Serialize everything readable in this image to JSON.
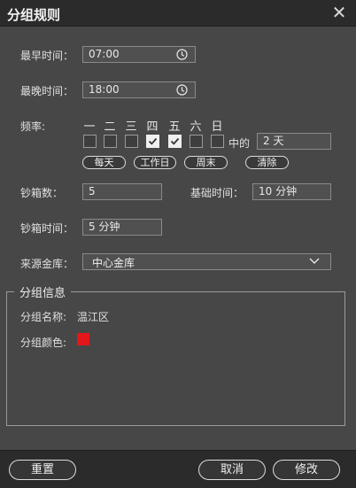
{
  "dialog": {
    "title": "分组规则",
    "close_icon": "close-icon"
  },
  "rules": {
    "earliest_time_label": "最早时间：",
    "earliest_time_value": "07:00",
    "latest_time_label": "最晚时间：",
    "latest_time_value": "18:00",
    "frequency_label": "频率:",
    "weekdays": [
      {
        "label": "一",
        "checked": false
      },
      {
        "label": "二",
        "checked": false
      },
      {
        "label": "三",
        "checked": false
      },
      {
        "label": "四",
        "checked": true
      },
      {
        "label": "五",
        "checked": true
      },
      {
        "label": "六",
        "checked": false
      },
      {
        "label": "日",
        "checked": false
      }
    ],
    "of_label": "中的",
    "days_count_value": "2 天",
    "presets": {
      "every_day": "每天",
      "workday": "工作日",
      "weekend": "周末",
      "clear": "清除"
    },
    "cashbox_count_label": "钞箱数：",
    "cashbox_count_value": "5",
    "base_time_label": "基础时间：",
    "base_time_value": "10 分钟",
    "cashbox_time_label": "钞箱时间：",
    "cashbox_time_value": "5 分钟",
    "source_vault_label": "来源金库：",
    "source_vault_value": "中心金库"
  },
  "group_info": {
    "legend": "分组信息",
    "name_label": "分组名称:",
    "name_value": "温江区",
    "color_label": "分组颜色:",
    "color_value": "#e3161a"
  },
  "footer": {
    "reset_label": "重置",
    "cancel_label": "取消",
    "modify_label": "修改"
  }
}
